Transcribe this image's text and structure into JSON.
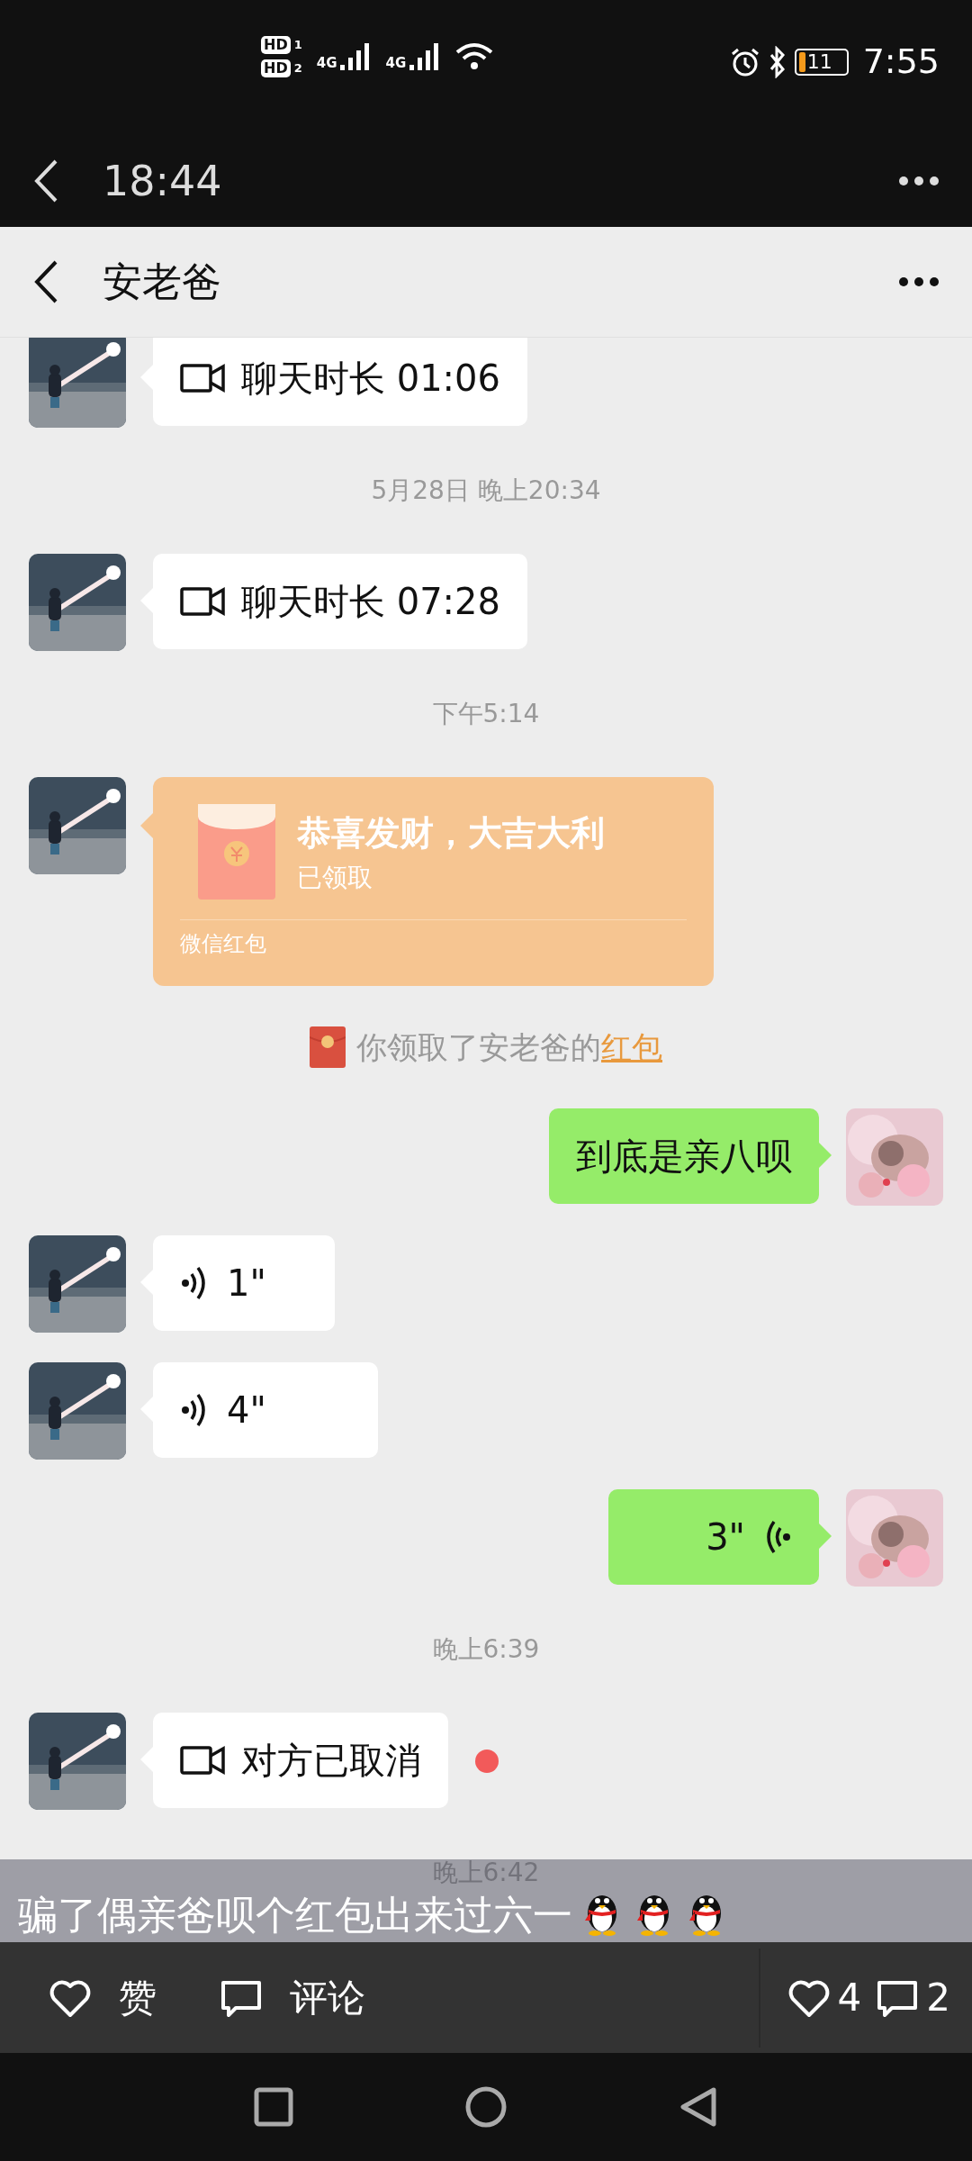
{
  "status_bar": {
    "sims": [
      {
        "hd": "HD",
        "slot": "1",
        "network": "4G"
      },
      {
        "hd": "HD",
        "slot": "2",
        "network": "4G"
      }
    ],
    "battery": "11",
    "time": "7:55"
  },
  "top_bar": {
    "title": "18:44"
  },
  "chat_header": {
    "title": "安老爸"
  },
  "messages": [
    {
      "kind": "video",
      "outgoing": false,
      "text": "聊天时长 01:06",
      "unread": false
    },
    {
      "kind": "time",
      "text": "5月28日 晚上20:34"
    },
    {
      "kind": "video",
      "outgoing": false,
      "text": "聊天时长 07:28",
      "unread": false
    },
    {
      "kind": "time",
      "text": "下午5:14"
    },
    {
      "kind": "red_packet",
      "outgoing": false,
      "title": "恭喜发财，大吉大利",
      "status": "已领取",
      "footer": "微信红包"
    },
    {
      "kind": "system",
      "text": "你领取了安老爸的",
      "link": "红包"
    },
    {
      "kind": "text",
      "outgoing": true,
      "text": "到底是亲八呗"
    },
    {
      "kind": "voice",
      "outgoing": false,
      "text": "1\""
    },
    {
      "kind": "voice",
      "outgoing": false,
      "text": "4\""
    },
    {
      "kind": "voice",
      "outgoing": true,
      "text": "3\""
    },
    {
      "kind": "time",
      "text": "晚上6:39"
    },
    {
      "kind": "video",
      "outgoing": false,
      "text": "对方已取消",
      "unread": true
    },
    {
      "kind": "time",
      "text": "晚上6:42"
    }
  ],
  "caption": {
    "text": "骗了偶亲爸呗个红包出来过六一"
  },
  "actions": [
    {
      "kind": "like",
      "label": "赞"
    },
    {
      "kind": "comment",
      "label": "评论"
    }
  ],
  "stats": [
    {
      "kind": "like",
      "count": "4"
    },
    {
      "kind": "comment",
      "count": "2"
    }
  ]
}
